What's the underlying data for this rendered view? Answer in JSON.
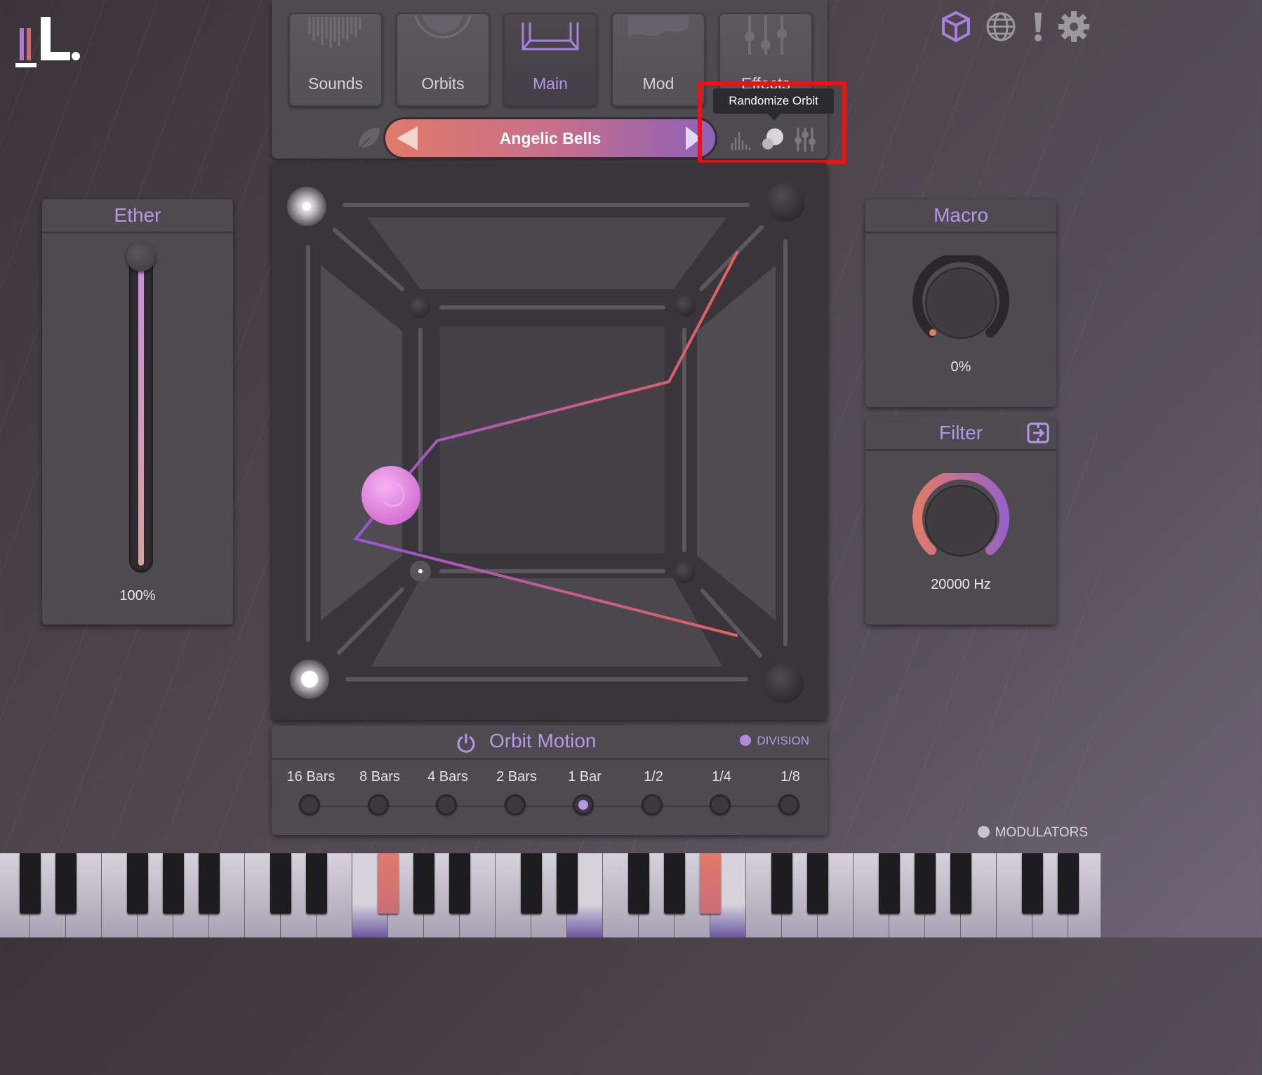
{
  "logo": {
    "text": "L"
  },
  "tabs": [
    {
      "label": "Sounds",
      "icon": "waveform-icon",
      "active": false
    },
    {
      "label": "Orbits",
      "icon": "orbit-icon",
      "active": false
    },
    {
      "label": "Main",
      "icon": "cube-frame-icon",
      "active": true
    },
    {
      "label": "Mod",
      "icon": "mod-wave-icon",
      "active": false
    },
    {
      "label": "Effects",
      "icon": "effects-sliders-icon",
      "active": false
    }
  ],
  "preset": {
    "name": "Angelic Bells"
  },
  "tooltip": {
    "text": "Randomize Orbit"
  },
  "ether": {
    "title": "Ether",
    "value": "100%",
    "level": 1.0
  },
  "macro": {
    "title": "Macro",
    "value": "0%",
    "level": 0.0
  },
  "filter": {
    "title": "Filter",
    "value": "20000 Hz"
  },
  "orbit_motion": {
    "title": "Orbit Motion",
    "division_label": "DIVISION",
    "options": [
      "16 Bars",
      "8 Bars",
      "4 Bars",
      "2 Bars",
      "1 Bar",
      "1/2",
      "1/4",
      "1/8"
    ],
    "selected": "1 Bar"
  },
  "modulators": {
    "label": "MODULATORS"
  },
  "colors": {
    "accent": "#b795e8",
    "orbit_start": "#e06060",
    "orbit_end": "#9a55d8",
    "ball": "#e58be0"
  },
  "top_icons": [
    "cube-icon",
    "globe-icon",
    "alert-icon",
    "gear-icon"
  ]
}
